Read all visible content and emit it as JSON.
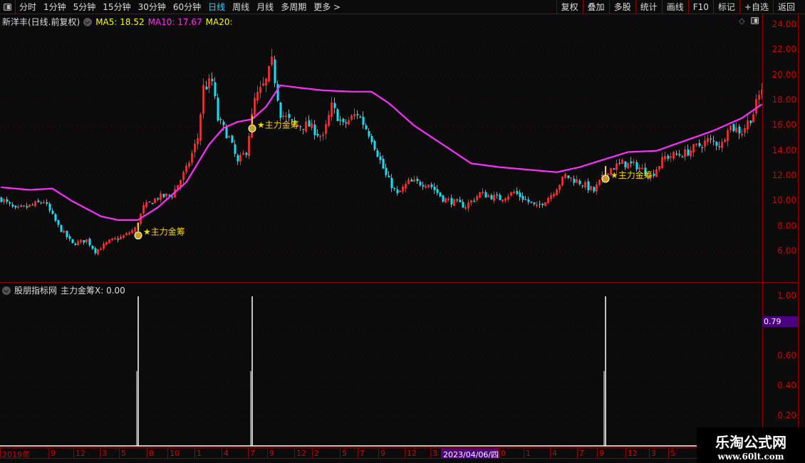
{
  "topbar": {
    "periods": [
      "分时",
      "1分钟",
      "5分钟",
      "15分钟",
      "30分钟",
      "60分钟",
      "日线",
      "周线",
      "月线",
      "多周期",
      "更多 >"
    ],
    "active": "日线",
    "buttons": [
      "复权",
      "叠加",
      "多股",
      "统计",
      "画线",
      "F10",
      "标记",
      "+自选",
      "返回"
    ]
  },
  "info": {
    "title": "新洋丰(日线.前复权)",
    "ma5": "MA5: 18.52",
    "ma10": "MA10: 17.67",
    "ma20": "MA20:"
  },
  "indicator": {
    "source": "股朋指标网",
    "label": "主力金筹X: 0.00",
    "current": "0.79",
    "signal_label": "★主力金筹"
  },
  "colors": {
    "up": "#ff3030",
    "down": "#00e5ff",
    "ma": "#ff30ff",
    "signal": "#ffd700",
    "axis": "#cc0000",
    "ma5": "#ffff00",
    "ma10": "#ff30ff"
  },
  "price_axis": {
    "ticks": [
      "24.00",
      "22.00",
      "20.00",
      "18.00",
      "16.00",
      "14.00",
      "12.00",
      "10.00",
      "8.00",
      "6.00"
    ],
    "range": [
      4.5,
      24.5
    ]
  },
  "ind_axis": {
    "ticks": [
      "1.00",
      "0.60",
      "0.40",
      "0.20"
    ],
    "range": [
      0,
      1.05
    ]
  },
  "time_axis": [
    "2019年",
    "9",
    "12",
    "3",
    "5",
    "8",
    "10",
    "1",
    "4",
    "7",
    "9",
    "12",
    "2",
    "5",
    "7",
    "9",
    "12",
    "3",
    "2023/04/06/四",
    "0",
    "1",
    "4",
    "7",
    "9",
    "12",
    "3",
    "5"
  ],
  "chart_data": {
    "type": "candlestick",
    "close_path": [
      [
        0,
        10.2
      ],
      [
        5,
        9.3
      ],
      [
        10,
        9.6
      ],
      [
        15,
        10.0
      ],
      [
        20,
        8.0
      ],
      [
        25,
        6.6
      ],
      [
        30,
        6.9
      ],
      [
        33,
        6.0
      ],
      [
        38,
        6.8
      ],
      [
        43,
        7.2
      ],
      [
        47,
        7.8
      ],
      [
        50,
        9.5
      ],
      [
        55,
        10.3
      ],
      [
        60,
        10.5
      ],
      [
        65,
        12.5
      ],
      [
        69,
        15
      ],
      [
        71,
        19
      ],
      [
        74,
        19.5
      ],
      [
        76,
        16.5
      ],
      [
        80,
        15
      ],
      [
        83,
        13
      ],
      [
        86,
        14
      ],
      [
        89,
        18
      ],
      [
        93,
        19.5
      ],
      [
        95,
        21
      ],
      [
        98,
        17
      ],
      [
        103,
        16
      ],
      [
        108,
        16
      ],
      [
        113,
        15
      ],
      [
        116,
        17.5
      ],
      [
        120,
        16
      ],
      [
        125,
        17
      ],
      [
        130,
        15
      ],
      [
        135,
        12
      ],
      [
        139,
        10.5
      ],
      [
        143,
        11.5
      ],
      [
        150,
        11.4
      ],
      [
        155,
        10.2
      ],
      [
        163,
        9.6
      ],
      [
        168,
        10.6
      ],
      [
        175,
        10.2
      ],
      [
        180,
        10.7
      ],
      [
        188,
        9.5
      ],
      [
        193,
        10.5
      ],
      [
        198,
        12
      ],
      [
        203,
        11.5
      ],
      [
        208,
        10.8
      ],
      [
        213,
        12.5
      ],
      [
        218,
        13
      ],
      [
        223,
        12.8
      ],
      [
        228,
        12
      ],
      [
        233,
        13.5
      ],
      [
        240,
        13.8
      ],
      [
        248,
        14.8
      ],
      [
        253,
        14.5
      ],
      [
        255,
        16
      ],
      [
        260,
        15.5
      ],
      [
        264,
        17
      ],
      [
        267,
        19
      ]
    ],
    "ma_path": [
      [
        0,
        11.1
      ],
      [
        10,
        10.9
      ],
      [
        18,
        11.0
      ],
      [
        25,
        10.0
      ],
      [
        35,
        8.8
      ],
      [
        41,
        8.5
      ],
      [
        48,
        8.5
      ],
      [
        55,
        9.5
      ],
      [
        65,
        11.5
      ],
      [
        73,
        14.5
      ],
      [
        78,
        15.8
      ],
      [
        83,
        16.3
      ],
      [
        88,
        16.5
      ],
      [
        93,
        17.5
      ],
      [
        98,
        19.2
      ],
      [
        105,
        19.0
      ],
      [
        113,
        18.8
      ],
      [
        123,
        18.7
      ],
      [
        130,
        18.7
      ],
      [
        136,
        17.8
      ],
      [
        145,
        16.0
      ],
      [
        155,
        14.5
      ],
      [
        165,
        13.0
      ],
      [
        175,
        12.7
      ],
      [
        185,
        12.5
      ],
      [
        195,
        12.3
      ],
      [
        203,
        12.7
      ],
      [
        210,
        13.2
      ],
      [
        220,
        13.9
      ],
      [
        230,
        14.0
      ],
      [
        240,
        14.8
      ],
      [
        250,
        15.6
      ],
      [
        260,
        16.6
      ],
      [
        267,
        17.7
      ]
    ],
    "signals": [
      {
        "bar": 48,
        "price": 7.5,
        "value": 1.0
      },
      {
        "bar": 88,
        "price": 16.0,
        "value": 1.0
      },
      {
        "bar": 212,
        "price": 12.0,
        "value": 1.0
      }
    ]
  }
}
